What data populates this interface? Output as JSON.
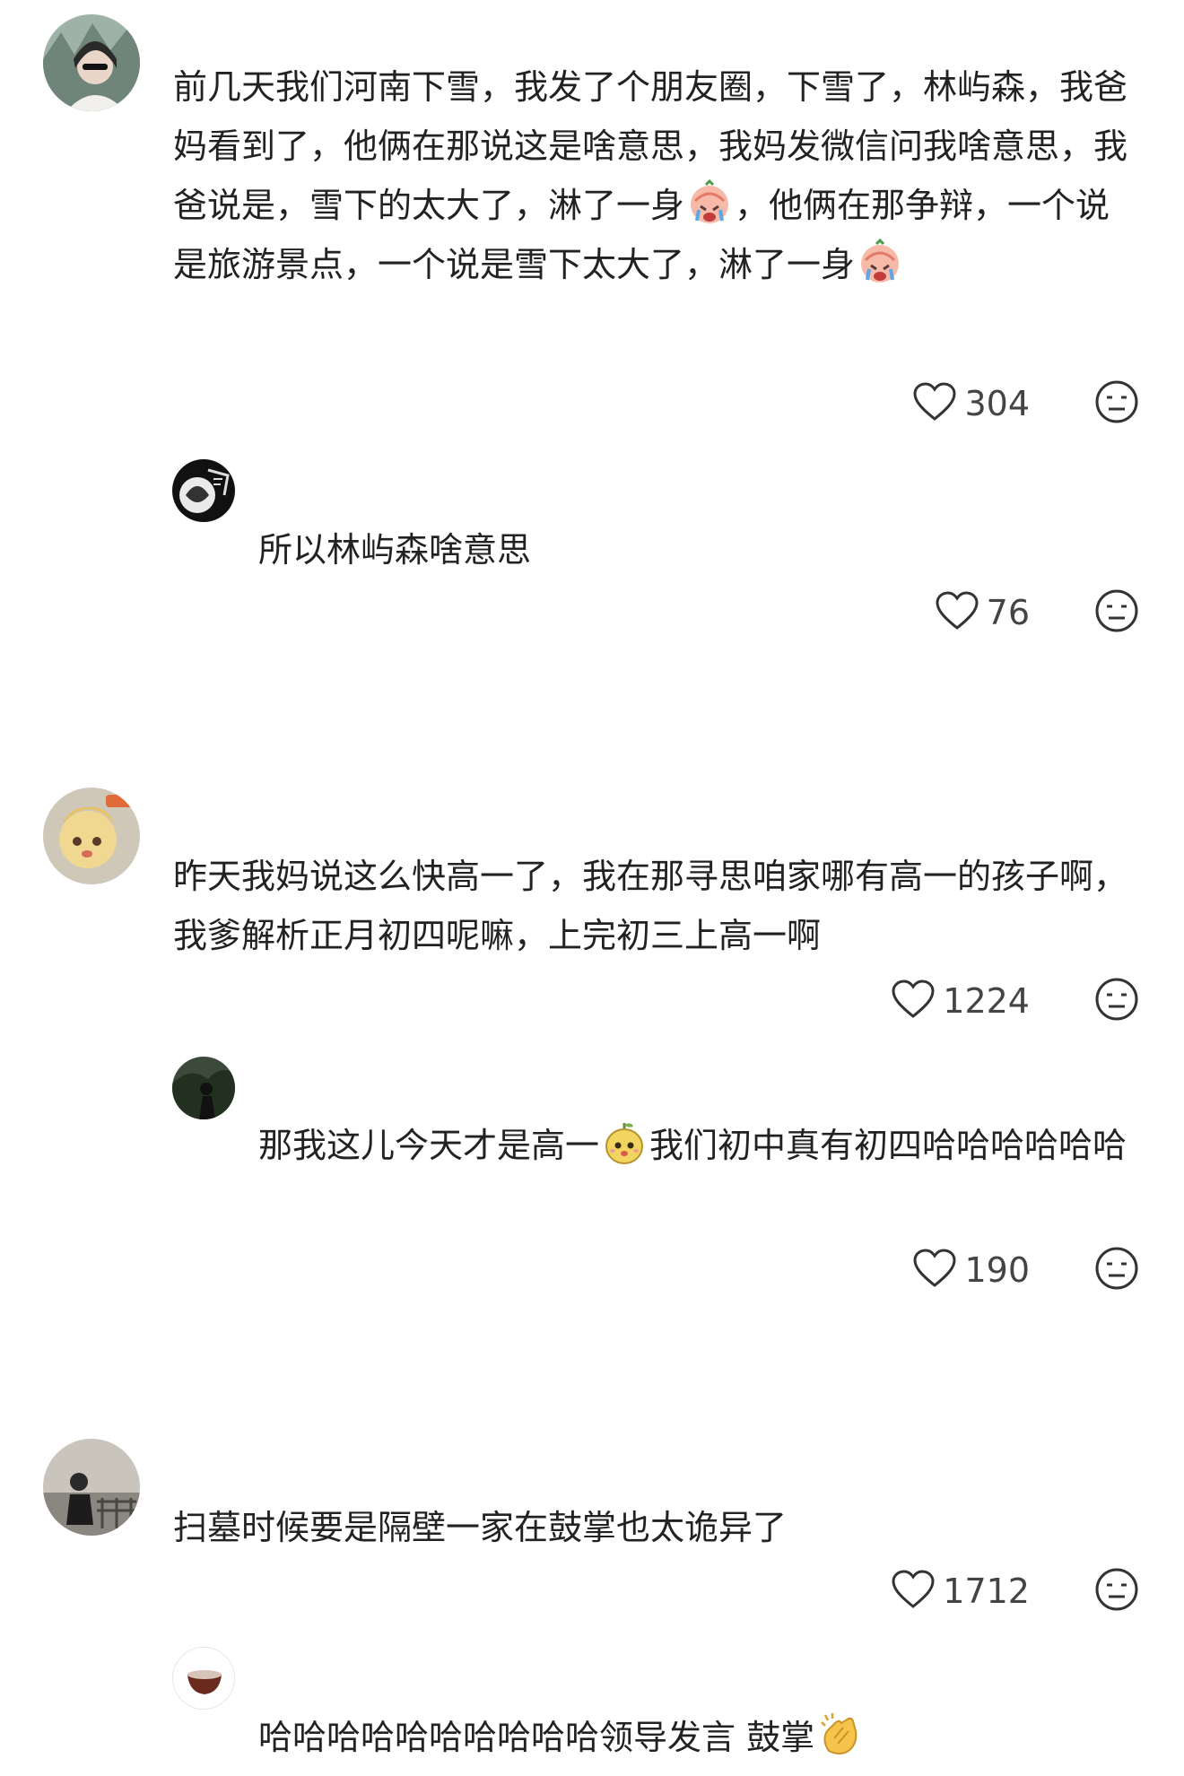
{
  "comments": [
    {
      "text": "前几天我们河南下雪，我发了个朋友圈，下雪了，林屿森，我爸妈看到了，他俩在那说这是啥意思，我妈发微信问我啥意思，我爸说是，雪下的太大了，淋了一身",
      "text2": "，他俩在那争辩，一个说是旅游景点，一个说是雪下太大了，淋了一身",
      "likes": "304",
      "reply": {
        "text": "所以林屿森啥意思",
        "likes": "76"
      }
    },
    {
      "text": "昨天我妈说这么快高一了，我在那寻思咱家哪有高一的孩子啊，我爹解析",
      "text2": "正月初四呢嘛，上完初三上高一啊",
      "likes": "1224",
      "reply": {
        "text": "那我这儿今天才是高一",
        "text2": "我们初中真有初四哈哈哈哈哈哈",
        "likes": "190"
      }
    },
    {
      "text": "扫墓时候要是隔壁一家在鼓掌也太诡异了",
      "likes": "1712",
      "reply": {
        "text": "哈哈哈哈哈哈哈哈哈哈领导发言 鼓掌"
      }
    }
  ],
  "icons": {
    "like": "heart-outline-icon",
    "dislike": "meh-face-icon",
    "emoji_cry": "crying-face-emoji",
    "emoji_pear": "cute-pear-emoji",
    "emoji_clap": "clapping-hands-emoji"
  },
  "colors": {
    "text": "#222222",
    "count": "#444444",
    "icon": "#333333"
  }
}
